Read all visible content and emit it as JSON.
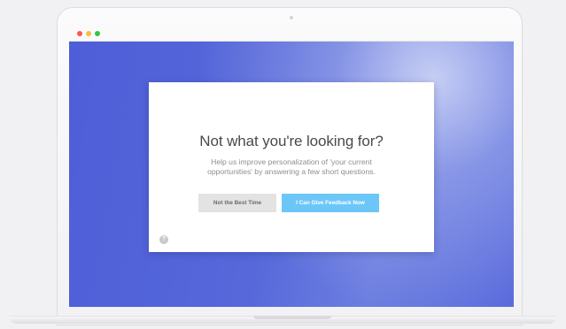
{
  "browser": {
    "traffic_lights": [
      "#fc5753",
      "#fdbc40",
      "#33c748"
    ]
  },
  "colors": {
    "background": "#4e5fd8",
    "primary_button": "#6cc7f8",
    "secondary_button": "#e3e3e3"
  },
  "modal": {
    "title": "Not what you're looking for?",
    "description": "Help us improve personalization of 'your current opportunities' by answering a few short questions.",
    "secondary_button_label": "Not the Best Time",
    "primary_button_label": "I Can Give Feedback Now",
    "help_icon": "question-mark-icon",
    "help_icon_glyph": "?"
  }
}
